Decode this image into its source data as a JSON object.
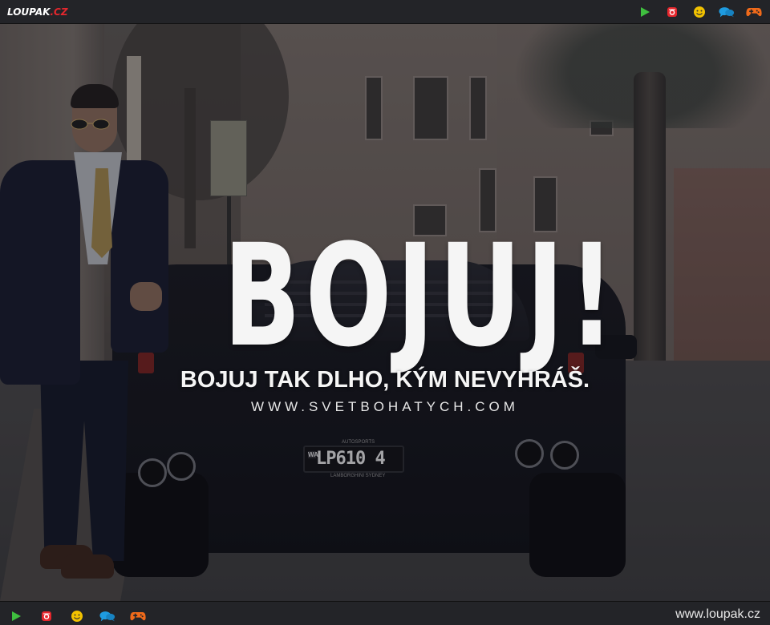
{
  "brand": {
    "logo_main": "LOUPAK",
    "logo_domain": ".CZ",
    "footer_site": "www.loupak.cz",
    "accent_red": "#e5272d"
  },
  "nav_icons": [
    {
      "name": "play-icon",
      "color": "#3fbf3f"
    },
    {
      "name": "instagram-icon",
      "color": "#e5272d"
    },
    {
      "name": "smiley-icon",
      "color": "#f2c200"
    },
    {
      "name": "chat-icon",
      "color": "#1e9be0"
    },
    {
      "name": "gamepad-icon",
      "color": "#f06a1a"
    }
  ],
  "poster": {
    "headline": "BOJUJ!",
    "subline": "BOJUJ TAK DLHO, KÝM NEVYHRÁŠ.",
    "url": "WWW.SVETBOHATYCH.COM"
  },
  "plate": {
    "state": "WA",
    "number": "LP610 4",
    "top_text": "AUTOSPORTS",
    "bottom_text": "LAMBORGHINI SYDNEY"
  }
}
